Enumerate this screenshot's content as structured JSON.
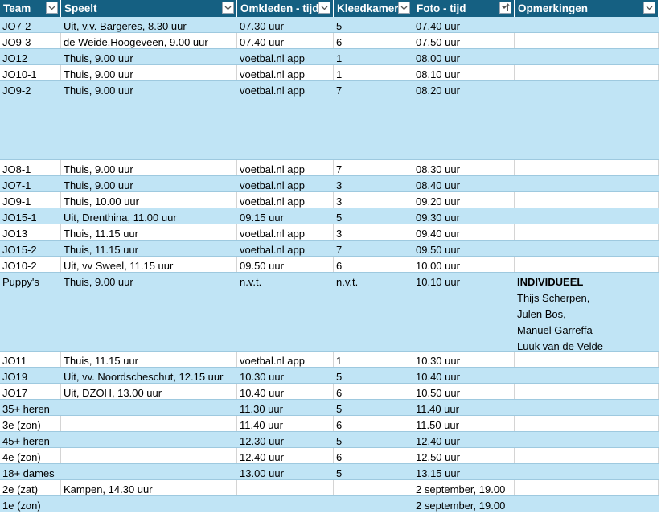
{
  "headers": [
    "Team",
    "Speelt",
    "Omkleden - tijd",
    "Kleedkamer",
    "Foto - tijd",
    "Opmerkingen"
  ],
  "header_icons": [
    "dropdown-arrow-icon",
    "dropdown-arrow-icon",
    "dropdown-arrow-icon",
    "dropdown-arrow-icon",
    "sort-ascending-filter-icon",
    "dropdown-arrow-icon"
  ],
  "colors": {
    "header_bg": "#156082",
    "band": "#c0e4f5",
    "header_text": "#ffffff"
  },
  "rows": [
    {
      "team": "JO7-2",
      "speelt": "Uit, v.v. Bargeres, 8.30 uur",
      "omkleden": "07.30 uur",
      "kleedkamer": "5",
      "foto": "07.40 uur",
      "opmerkingen": []
    },
    {
      "team": "JO9-3",
      "speelt": "de Weide,Hoogeveen, 9.00 uur",
      "omkleden": "07.40 uur",
      "kleedkamer": "6",
      "foto": "07.50 uur",
      "opmerkingen": []
    },
    {
      "team": "JO12",
      "speelt": "Thuis, 9.00 uur",
      "omkleden": "voetbal.nl app",
      "kleedkamer": "1",
      "foto": "08.00 uur",
      "opmerkingen": []
    },
    {
      "team": "JO10-1",
      "speelt": "Thuis, 9.00 uur",
      "omkleden": "voetbal.nl app",
      "kleedkamer": "1",
      "foto": "08.10 uur",
      "opmerkingen": []
    },
    {
      "team": "JO9-2",
      "speelt": "Thuis, 9.00 uur",
      "omkleden": "voetbal.nl app",
      "kleedkamer": "7",
      "foto": "08.20 uur",
      "opmerkingen": []
    },
    {
      "team": "JO8-1",
      "speelt": "Thuis, 9.00 uur",
      "omkleden": "voetbal.nl app",
      "kleedkamer": "7",
      "foto": "08.30 uur",
      "opmerkingen": []
    },
    {
      "team": "JO7-1",
      "speelt": "Thuis, 9.00 uur",
      "omkleden": "voetbal.nl app",
      "kleedkamer": "3",
      "foto": "08.40 uur",
      "opmerkingen": []
    },
    {
      "team": "JO9-1",
      "speelt": "Thuis, 10.00 uur",
      "omkleden": "voetbal.nl app",
      "kleedkamer": "3",
      "foto": "09.20 uur",
      "opmerkingen": []
    },
    {
      "team": "JO15-1",
      "speelt": "Uit, Drenthina, 11.00 uur",
      "omkleden": "09.15 uur",
      "kleedkamer": "5",
      "foto": "09.30 uur",
      "opmerkingen": []
    },
    {
      "team": "JO13",
      "speelt": "Thuis, 11.15 uur",
      "omkleden": "voetbal.nl app",
      "kleedkamer": "3",
      "foto": "09.40 uur",
      "opmerkingen": []
    },
    {
      "team": "JO15-2",
      "speelt": "Thuis, 11.15 uur",
      "omkleden": "voetbal.nl app",
      "kleedkamer": "7",
      "foto": "09.50 uur",
      "opmerkingen": []
    },
    {
      "team": "JO10-2",
      "speelt": "Uit, vv Sweel, 11.15 uur",
      "omkleden": "09.50 uur",
      "kleedkamer": "6",
      "foto": "10.00 uur",
      "opmerkingen": []
    },
    {
      "team": "Puppy's",
      "speelt": "Thuis, 9.00 uur",
      "omkleden": "n.v.t.",
      "kleedkamer": "n.v.t.",
      "foto": "10.10 uur",
      "opmerkingen": [
        "INDIVIDUEEL",
        "Thijs Scherpen,",
        "Julen Bos,",
        "Manuel Garreffa",
        "Luuk van de Velde"
      ]
    },
    {
      "team": "JO11",
      "speelt": "Thuis, 11.15 uur",
      "omkleden": "voetbal.nl app",
      "kleedkamer": "1",
      "foto": "10.30 uur",
      "opmerkingen": []
    },
    {
      "team": "JO19",
      "speelt": "Uit, vv. Noordscheschut, 12.15 uur",
      "omkleden": "10.30 uur",
      "kleedkamer": "5",
      "foto": "10.40 uur",
      "opmerkingen": []
    },
    {
      "team": "JO17",
      "speelt": "Uit, DZOH, 13.00 uur",
      "omkleden": "10.40 uur",
      "kleedkamer": "6",
      "foto": "10.50 uur",
      "opmerkingen": []
    },
    {
      "team": "35+ heren",
      "speelt": "",
      "omkleden": "11.30 uur",
      "kleedkamer": "5",
      "foto": "11.40 uur",
      "opmerkingen": []
    },
    {
      "team": "3e (zon)",
      "speelt": "",
      "omkleden": "11.40 uur",
      "kleedkamer": "6",
      "foto": "11.50 uur",
      "opmerkingen": []
    },
    {
      "team": "45+ heren",
      "speelt": "",
      "omkleden": "12.30 uur",
      "kleedkamer": "5",
      "foto": "12.40 uur",
      "opmerkingen": []
    },
    {
      "team": "4e (zon)",
      "speelt": "",
      "omkleden": "12.40 uur",
      "kleedkamer": "6",
      "foto": "12.50 uur",
      "opmerkingen": []
    },
    {
      "team": "18+ dames",
      "speelt": "",
      "omkleden": "13.00 uur",
      "kleedkamer": "5",
      "foto": "13.15 uur",
      "opmerkingen": []
    },
    {
      "team": "2e (zat)",
      "speelt": "Kampen, 14.30 uur",
      "omkleden": "",
      "kleedkamer": "",
      "foto": "2 september, 19.00",
      "opmerkingen": []
    },
    {
      "team": "1e (zon)",
      "speelt": "",
      "omkleden": "",
      "kleedkamer": "",
      "foto": "2 september, 19.00",
      "opmerkingen": []
    }
  ]
}
